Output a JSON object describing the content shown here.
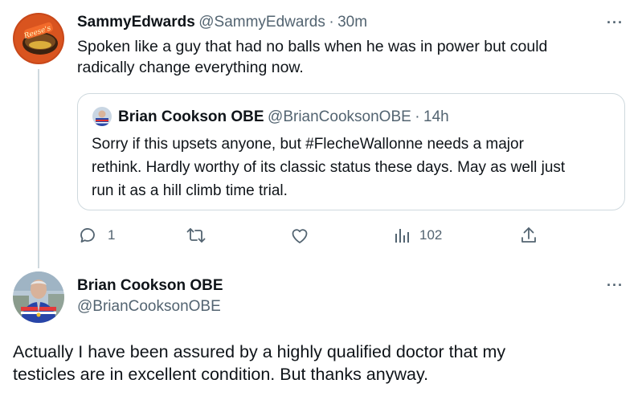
{
  "reply": {
    "name": "SammyEdwards",
    "handle": "@SammyEdwards",
    "separator": "·",
    "time": "30m",
    "text_line1": "Spoken like a guy that had no balls when he was in power but could",
    "text_line2": "radically change everything now.",
    "avatar_text": "Reese's",
    "more_label": "···"
  },
  "quote": {
    "name": "Brian Cookson OBE",
    "handle": "@BrianCooksonOBE",
    "separator": "·",
    "time": "14h",
    "text_line1": "Sorry if this upsets anyone, but #FlecheWallonne needs a major",
    "text_line2": "rethink. Hardly worthy of its classic status these days. May as well just",
    "text_line3": "run it as a hill climb time trial."
  },
  "actions": {
    "reply_count": "1",
    "views_count": "102",
    "reply_icon": "reply-icon",
    "retweet_icon": "retweet-icon",
    "like_icon": "heart-icon",
    "views_icon": "views-icon",
    "share_icon": "share-icon"
  },
  "main_tweet": {
    "name": "Brian Cookson OBE",
    "handle": "@BrianCooksonOBE",
    "text_line1": "Actually I have been assured by a highly qualified doctor that my",
    "text_line2": "testicles are in excellent condition. But thanks anyway.",
    "more_label": "···"
  },
  "colors": {
    "text_primary": "#0f1419",
    "text_secondary": "#536471",
    "border": "#cfd9de"
  }
}
